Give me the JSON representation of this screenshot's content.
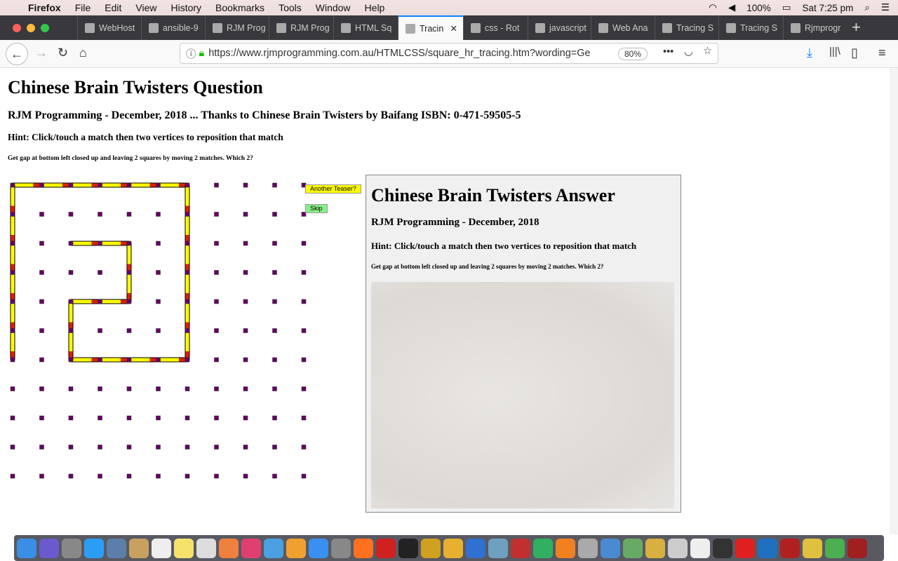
{
  "menubar": {
    "app": "Firefox",
    "items": [
      "File",
      "Edit",
      "View",
      "History",
      "Bookmarks",
      "Tools",
      "Window",
      "Help"
    ],
    "battery": "100%",
    "clock": "Sat 7:25 pm"
  },
  "tabs": [
    {
      "label": "WebHost"
    },
    {
      "label": "ansible-9"
    },
    {
      "label": "RJM Prog"
    },
    {
      "label": "RJM Prog"
    },
    {
      "label": "HTML Sq"
    },
    {
      "label": "Tracin",
      "active": true
    },
    {
      "label": "css - Rot"
    },
    {
      "label": "javascript"
    },
    {
      "label": "Web Ana"
    },
    {
      "label": "Tracing S"
    },
    {
      "label": "Tracing S"
    },
    {
      "label": "Rjmprogr"
    }
  ],
  "navbar": {
    "url": "https://www.rjmprogramming.com.au/HTMLCSS/square_hr_tracing.htm?wording=Ge",
    "zoom": "80%"
  },
  "page": {
    "title": "Chinese Brain Twisters Question",
    "subtitle": "RJM Programming - December, 2018 ... Thanks to Chinese Brain Twisters by Baifang ISBN: 0-471-59505-5",
    "hint": "Hint: Click/touch a match then two vertices to reposition that match",
    "task": "Get gap at bottom left closed up and leaving 2 squares by moving 2 matches. Which 2?",
    "another_button": "Another Teaser?",
    "skip_button": "Skip"
  },
  "board": {
    "grid_size": 11,
    "match_color": "#ffff00",
    "head_color": "#dd2200",
    "vertex_color": "#660066",
    "matches": [
      [
        0,
        0,
        1,
        0
      ],
      [
        1,
        0,
        2,
        0
      ],
      [
        2,
        0,
        3,
        0
      ],
      [
        3,
        0,
        4,
        0
      ],
      [
        4,
        0,
        5,
        0
      ],
      [
        5,
        0,
        6,
        0
      ],
      [
        0,
        0,
        0,
        1
      ],
      [
        0,
        1,
        0,
        2
      ],
      [
        0,
        2,
        0,
        3
      ],
      [
        0,
        3,
        0,
        4
      ],
      [
        0,
        4,
        0,
        5
      ],
      [
        0,
        5,
        0,
        6
      ],
      [
        6,
        0,
        6,
        1
      ],
      [
        6,
        1,
        6,
        2
      ],
      [
        6,
        2,
        6,
        3
      ],
      [
        6,
        3,
        6,
        4
      ],
      [
        6,
        4,
        6,
        5
      ],
      [
        6,
        5,
        6,
        6
      ],
      [
        2,
        6,
        3,
        6
      ],
      [
        3,
        6,
        4,
        6
      ],
      [
        4,
        6,
        5,
        6
      ],
      [
        5,
        6,
        6,
        6
      ],
      [
        2,
        2,
        3,
        2
      ],
      [
        3,
        2,
        4,
        2
      ],
      [
        4,
        2,
        4,
        3
      ],
      [
        4,
        3,
        4,
        4
      ],
      [
        2,
        4,
        3,
        4
      ],
      [
        3,
        4,
        4,
        4
      ],
      [
        2,
        4,
        2,
        5
      ],
      [
        2,
        5,
        2,
        6
      ]
    ]
  },
  "answer": {
    "title": "Chinese Brain Twisters Answer",
    "subtitle": "RJM Programming - December, 2018",
    "hint": "Hint: Click/touch a match then two vertices to reposition that match",
    "task": "Get gap at bottom left closed up and leaving 2 squares by moving 2 matches. Which 2?"
  }
}
